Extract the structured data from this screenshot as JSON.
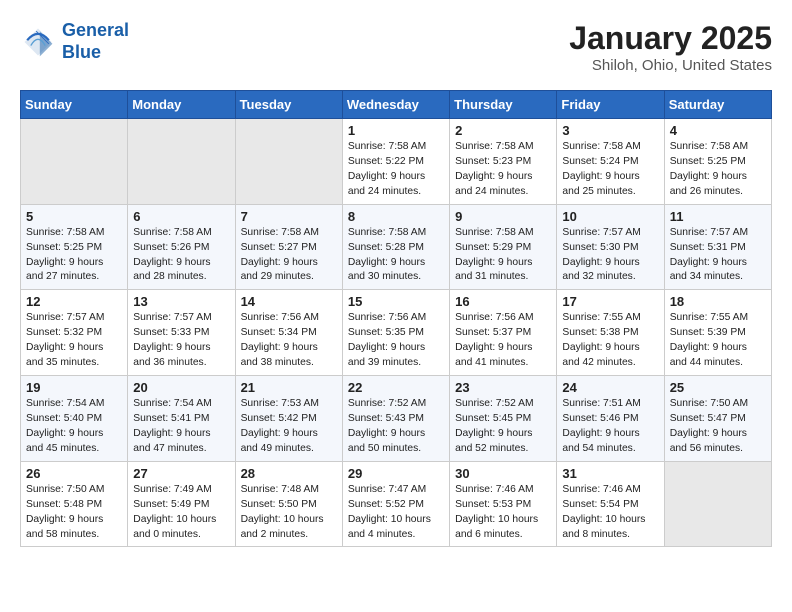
{
  "header": {
    "logo_line1": "General",
    "logo_line2": "Blue",
    "month": "January 2025",
    "location": "Shiloh, Ohio, United States"
  },
  "weekdays": [
    "Sunday",
    "Monday",
    "Tuesday",
    "Wednesday",
    "Thursday",
    "Friday",
    "Saturday"
  ],
  "weeks": [
    [
      {
        "day": "",
        "info": ""
      },
      {
        "day": "",
        "info": ""
      },
      {
        "day": "",
        "info": ""
      },
      {
        "day": "1",
        "info": "Sunrise: 7:58 AM\nSunset: 5:22 PM\nDaylight: 9 hours\nand 24 minutes."
      },
      {
        "day": "2",
        "info": "Sunrise: 7:58 AM\nSunset: 5:23 PM\nDaylight: 9 hours\nand 24 minutes."
      },
      {
        "day": "3",
        "info": "Sunrise: 7:58 AM\nSunset: 5:24 PM\nDaylight: 9 hours\nand 25 minutes."
      },
      {
        "day": "4",
        "info": "Sunrise: 7:58 AM\nSunset: 5:25 PM\nDaylight: 9 hours\nand 26 minutes."
      }
    ],
    [
      {
        "day": "5",
        "info": "Sunrise: 7:58 AM\nSunset: 5:25 PM\nDaylight: 9 hours\nand 27 minutes."
      },
      {
        "day": "6",
        "info": "Sunrise: 7:58 AM\nSunset: 5:26 PM\nDaylight: 9 hours\nand 28 minutes."
      },
      {
        "day": "7",
        "info": "Sunrise: 7:58 AM\nSunset: 5:27 PM\nDaylight: 9 hours\nand 29 minutes."
      },
      {
        "day": "8",
        "info": "Sunrise: 7:58 AM\nSunset: 5:28 PM\nDaylight: 9 hours\nand 30 minutes."
      },
      {
        "day": "9",
        "info": "Sunrise: 7:58 AM\nSunset: 5:29 PM\nDaylight: 9 hours\nand 31 minutes."
      },
      {
        "day": "10",
        "info": "Sunrise: 7:57 AM\nSunset: 5:30 PM\nDaylight: 9 hours\nand 32 minutes."
      },
      {
        "day": "11",
        "info": "Sunrise: 7:57 AM\nSunset: 5:31 PM\nDaylight: 9 hours\nand 34 minutes."
      }
    ],
    [
      {
        "day": "12",
        "info": "Sunrise: 7:57 AM\nSunset: 5:32 PM\nDaylight: 9 hours\nand 35 minutes."
      },
      {
        "day": "13",
        "info": "Sunrise: 7:57 AM\nSunset: 5:33 PM\nDaylight: 9 hours\nand 36 minutes."
      },
      {
        "day": "14",
        "info": "Sunrise: 7:56 AM\nSunset: 5:34 PM\nDaylight: 9 hours\nand 38 minutes."
      },
      {
        "day": "15",
        "info": "Sunrise: 7:56 AM\nSunset: 5:35 PM\nDaylight: 9 hours\nand 39 minutes."
      },
      {
        "day": "16",
        "info": "Sunrise: 7:56 AM\nSunset: 5:37 PM\nDaylight: 9 hours\nand 41 minutes."
      },
      {
        "day": "17",
        "info": "Sunrise: 7:55 AM\nSunset: 5:38 PM\nDaylight: 9 hours\nand 42 minutes."
      },
      {
        "day": "18",
        "info": "Sunrise: 7:55 AM\nSunset: 5:39 PM\nDaylight: 9 hours\nand 44 minutes."
      }
    ],
    [
      {
        "day": "19",
        "info": "Sunrise: 7:54 AM\nSunset: 5:40 PM\nDaylight: 9 hours\nand 45 minutes."
      },
      {
        "day": "20",
        "info": "Sunrise: 7:54 AM\nSunset: 5:41 PM\nDaylight: 9 hours\nand 47 minutes."
      },
      {
        "day": "21",
        "info": "Sunrise: 7:53 AM\nSunset: 5:42 PM\nDaylight: 9 hours\nand 49 minutes."
      },
      {
        "day": "22",
        "info": "Sunrise: 7:52 AM\nSunset: 5:43 PM\nDaylight: 9 hours\nand 50 minutes."
      },
      {
        "day": "23",
        "info": "Sunrise: 7:52 AM\nSunset: 5:45 PM\nDaylight: 9 hours\nand 52 minutes."
      },
      {
        "day": "24",
        "info": "Sunrise: 7:51 AM\nSunset: 5:46 PM\nDaylight: 9 hours\nand 54 minutes."
      },
      {
        "day": "25",
        "info": "Sunrise: 7:50 AM\nSunset: 5:47 PM\nDaylight: 9 hours\nand 56 minutes."
      }
    ],
    [
      {
        "day": "26",
        "info": "Sunrise: 7:50 AM\nSunset: 5:48 PM\nDaylight: 9 hours\nand 58 minutes."
      },
      {
        "day": "27",
        "info": "Sunrise: 7:49 AM\nSunset: 5:49 PM\nDaylight: 10 hours\nand 0 minutes."
      },
      {
        "day": "28",
        "info": "Sunrise: 7:48 AM\nSunset: 5:50 PM\nDaylight: 10 hours\nand 2 minutes."
      },
      {
        "day": "29",
        "info": "Sunrise: 7:47 AM\nSunset: 5:52 PM\nDaylight: 10 hours\nand 4 minutes."
      },
      {
        "day": "30",
        "info": "Sunrise: 7:46 AM\nSunset: 5:53 PM\nDaylight: 10 hours\nand 6 minutes."
      },
      {
        "day": "31",
        "info": "Sunrise: 7:46 AM\nSunset: 5:54 PM\nDaylight: 10 hours\nand 8 minutes."
      },
      {
        "day": "",
        "info": ""
      }
    ]
  ]
}
